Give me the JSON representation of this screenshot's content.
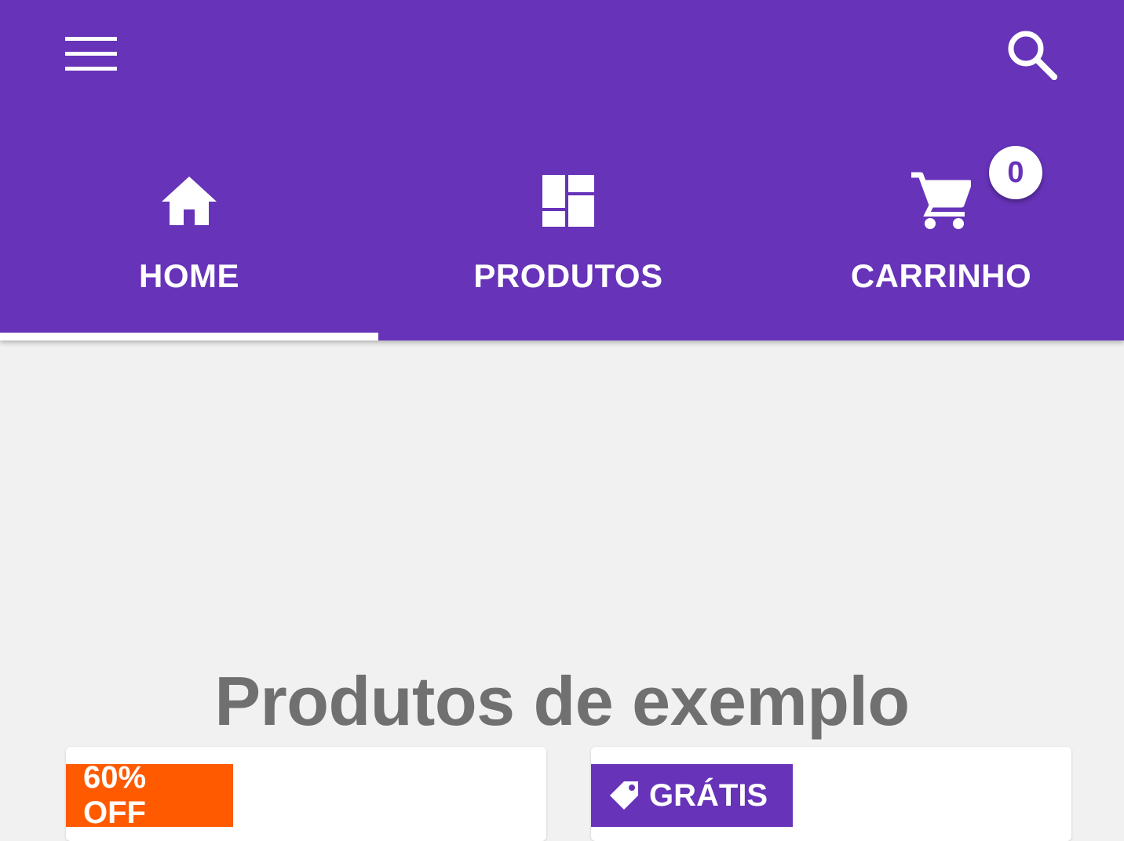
{
  "colors": {
    "primary": "#6633b9",
    "background": "#f1f1f1",
    "accent_discount": "#ff5a00",
    "title_text": "#707070"
  },
  "toolbar": {
    "menu_icon": "hamburger-menu-icon",
    "search_icon": "search-icon"
  },
  "tabs": [
    {
      "label": "HOME",
      "icon": "home-icon",
      "selected": true
    },
    {
      "label": "PRODUTOS",
      "icon": "dashboard-icon",
      "selected": false
    },
    {
      "label": "CARRINHO",
      "icon": "cart-icon",
      "selected": false
    }
  ],
  "cart": {
    "count": "0"
  },
  "main": {
    "title": "Produtos de exemplo",
    "cards": [
      {
        "badge": "60% OFF"
      },
      {
        "badge": "GRÁTIS",
        "badge_icon": "tag-icon"
      }
    ]
  }
}
